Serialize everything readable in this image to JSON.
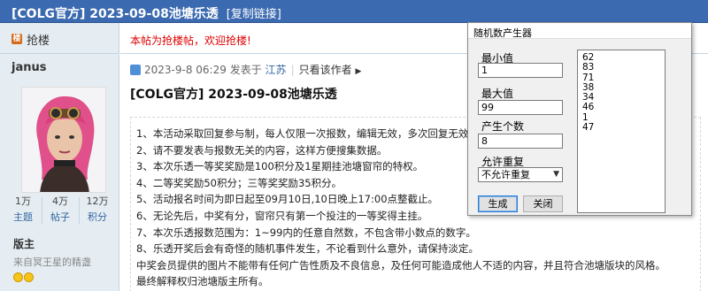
{
  "title_bar": {
    "title": "[COLG官方] 2023-09-08池塘乐透",
    "copy_link": "[复制链接]"
  },
  "left": {
    "floor_label": "抢楼",
    "floor_icon": "lou-icon",
    "username": "janus",
    "stats": [
      {
        "value": "1万",
        "label": "主题"
      },
      {
        "value": "4万",
        "label": "帖子"
      },
      {
        "value": "12万",
        "label": "积分"
      }
    ],
    "role": "版主",
    "role_sub": "来自冥王星的精盏"
  },
  "main": {
    "notice": "本帖为抢楼帖，欢迎抢楼!",
    "meta_time": "2023-9-8 06:29",
    "meta_posted_from": "发表于",
    "meta_location": "江苏",
    "meta_only_author": "只看该作者",
    "post_title": "[COLG官方] 2023-09-08池塘乐透",
    "content_lines": [
      "1、本活动采取回复参与制，每人仅限一次报数，编辑无效，多次回复无效。",
      "2、请不要发表与报数无关的内容，这样方便搜集数据。",
      "3、本次乐透一等奖奖励是100积分及1星期挂池塘窗帘的特权。",
      "4、二等奖奖励50积分；三等奖奖励35积分。",
      "5、活动报名时间为即日起至09月10日,10日晚上17:00点整截止。",
      "6、无论先后，中奖有分，窗帘只有第一个投注的一等奖得主挂。",
      "7、本次乐透报数范围为：1~99内的任意自然数，不包含带小数点的数字。",
      "8、乐透开奖后会有奇怪的随机事件发生，不论看到什么意外，请保持淡定。",
      "中奖会员提供的图片不能带有任何广告性质及不良信息，及任何可能造成他人不适的内容，并且符合池塘版块的风格。",
      "最终解释权归池塘版主所有。"
    ]
  },
  "rng": {
    "window_title": "随机数产生器",
    "min_label": "最小值",
    "min_value": "1",
    "max_label": "最大值",
    "max_value": "99",
    "count_label": "产生个数",
    "count_value": "8",
    "repeat_label": "允许重复",
    "repeat_selected": "不允许重复",
    "generate_label": "生成",
    "close_label": "关闭",
    "results": [
      "62",
      "83",
      "71",
      "38",
      "34",
      "46",
      "1",
      "47"
    ]
  },
  "colors": {
    "title_bar": "#3b6ab0",
    "side_bg": "#e5edf2",
    "notice_red": "#e00000",
    "link_blue": "#3366a0"
  }
}
